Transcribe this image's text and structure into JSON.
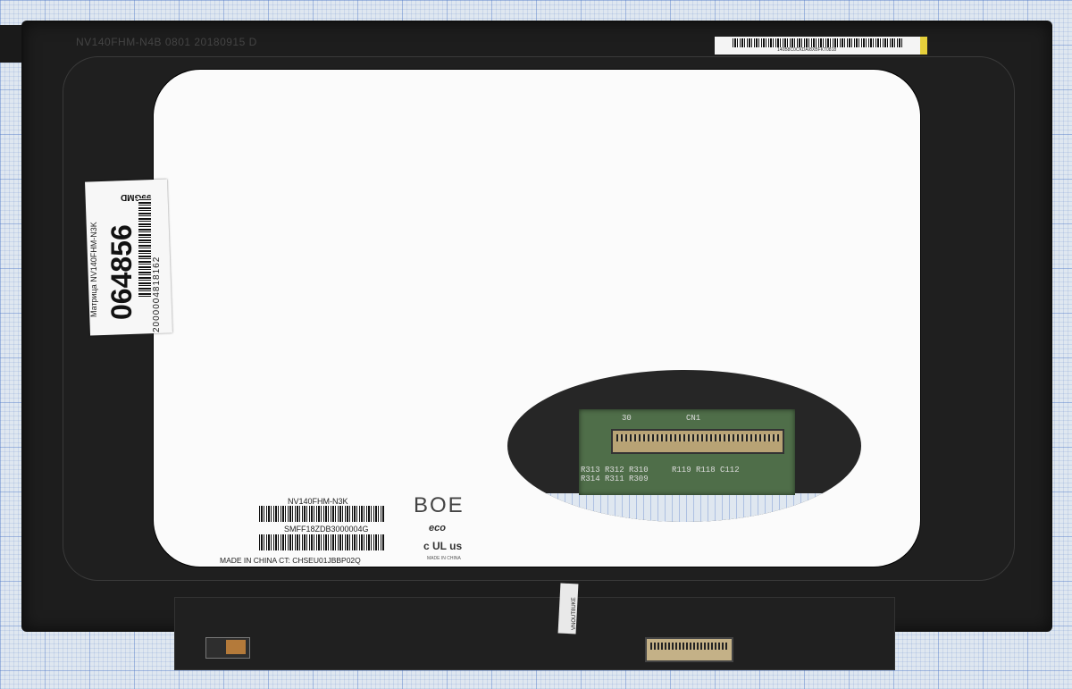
{
  "panel": {
    "top_print": "NV140FHM-N4B 0801 20180915 D",
    "top_sticker_text": "140B8C0CKDA/8XBFKT0818"
  },
  "label": {
    "code": "99GMD",
    "article": "064856",
    "description": "Матрица NV140FHM-N3K",
    "number": "2000004818162"
  },
  "screen_labels": {
    "model": "NV140FHM-N3K",
    "serial": "SMFF18ZDB3000004G",
    "made_in": "MADE IN CHINA  CT: CHSEU01JBBP02Q"
  },
  "logos": {
    "brand": "BOE",
    "eco": "eco",
    "ul": "c UL us",
    "made_small": "MADE IN CHINA"
  },
  "inset": {
    "pcb_30": "30",
    "pcb_cn1": "CN1",
    "pcb_r_row1": "R313 R312 R310",
    "pcb_r_row2": "R314 R311 R309",
    "pcb_r_row3": "R119 R118 C112"
  },
  "tab": {
    "text": "VNOUT8UKE"
  }
}
